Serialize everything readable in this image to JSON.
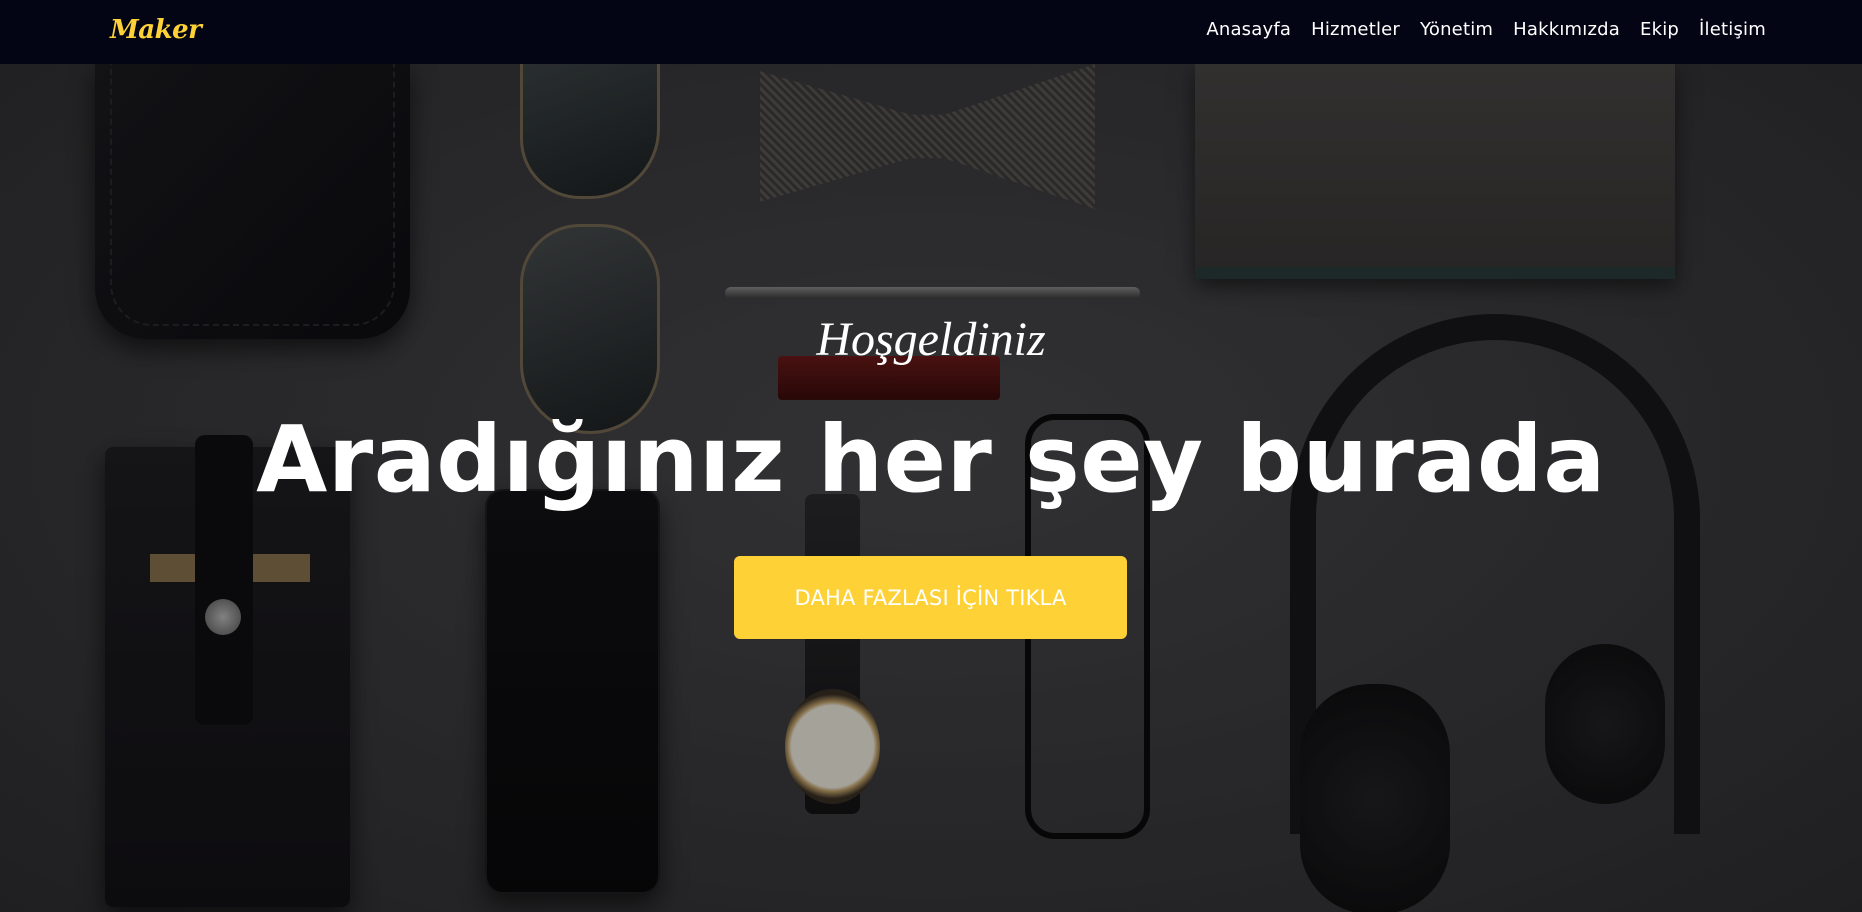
{
  "navbar": {
    "brand": "Maker",
    "links": [
      "Anasayfa",
      "Hizmetler",
      "Yönetim",
      "Hakkımızda",
      "Ekip",
      "İletişim"
    ]
  },
  "hero": {
    "subtitle": "Hoşgeldiniz",
    "title": "Aradığınız her şey burada",
    "cta_label": "DAHA FAZLASI İÇİN TIKLA"
  },
  "colors": {
    "navbar_bg": "#030514",
    "accent": "#fed136",
    "text": "#ffffff"
  }
}
